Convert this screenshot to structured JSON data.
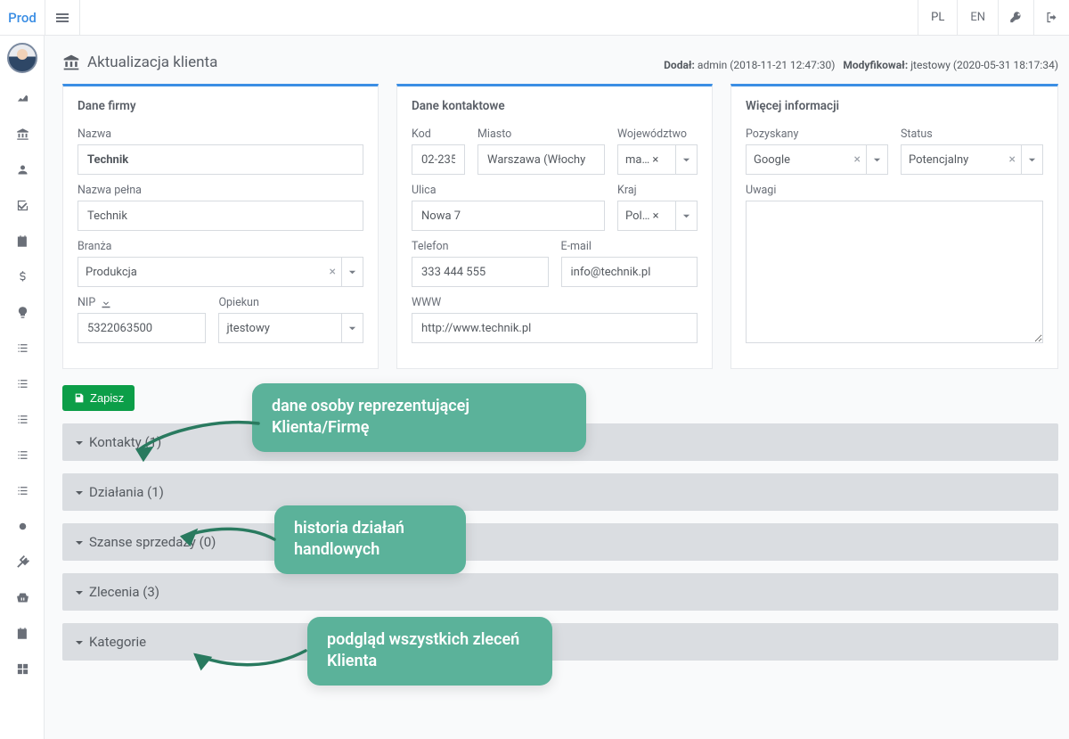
{
  "brand": "Prod",
  "lang": {
    "pl": "PL",
    "en": "EN"
  },
  "page": {
    "title": "Aktualizacja klienta",
    "added_label": "Dodał:",
    "added_value": "admin (2018-11-21 12:47:30)",
    "modified_label": "Modyfikował:",
    "modified_value": "jtestowy (2020-05-31 18:17:34)"
  },
  "panels": {
    "company": {
      "title": "Dane firmy",
      "name_label": "Nazwa",
      "name_value": "Technik",
      "fullname_label": "Nazwa pełna",
      "fullname_value": "Technik",
      "industry_label": "Branża",
      "industry_value": "Produkcja",
      "nip_label": "NIP",
      "nip_value": "5322063500",
      "owner_label": "Opiekun",
      "owner_value": "jtestowy"
    },
    "contact": {
      "title": "Dane kontaktowe",
      "code_label": "Kod",
      "code_value": "02-235",
      "city_label": "Miasto",
      "city_value": "Warszawa (Włochy",
      "region_label": "Województwo",
      "region_value": "ma… ×",
      "street_label": "Ulica",
      "street_value": "Nowa 7",
      "country_label": "Kraj",
      "country_value": "Pol… ×",
      "phone_label": "Telefon",
      "phone_value": "333 444 555",
      "email_label": "E-mail",
      "email_value": "info@technik.pl",
      "www_label": "WWW",
      "www_value": "http://www.technik.pl"
    },
    "more": {
      "title": "Więcej informacji",
      "acquired_label": "Pozyskany",
      "acquired_value": "Google",
      "status_label": "Status",
      "status_value": "Potencjalny",
      "notes_label": "Uwagi",
      "notes_value": ""
    }
  },
  "save_label": "Zapisz",
  "accordions": {
    "contacts": "Kontakty (1)",
    "actions": "Działania (1)",
    "opportunities": "Szanse sprzedaży (0)",
    "orders": "Zlecenia (3)",
    "categories": "Kategorie"
  },
  "annotations": {
    "a1": "dane osoby reprezentującej Klienta/Firmę",
    "a2": "historia działań handlowych",
    "a3": "podgląd wszystkich zleceń Klienta"
  }
}
